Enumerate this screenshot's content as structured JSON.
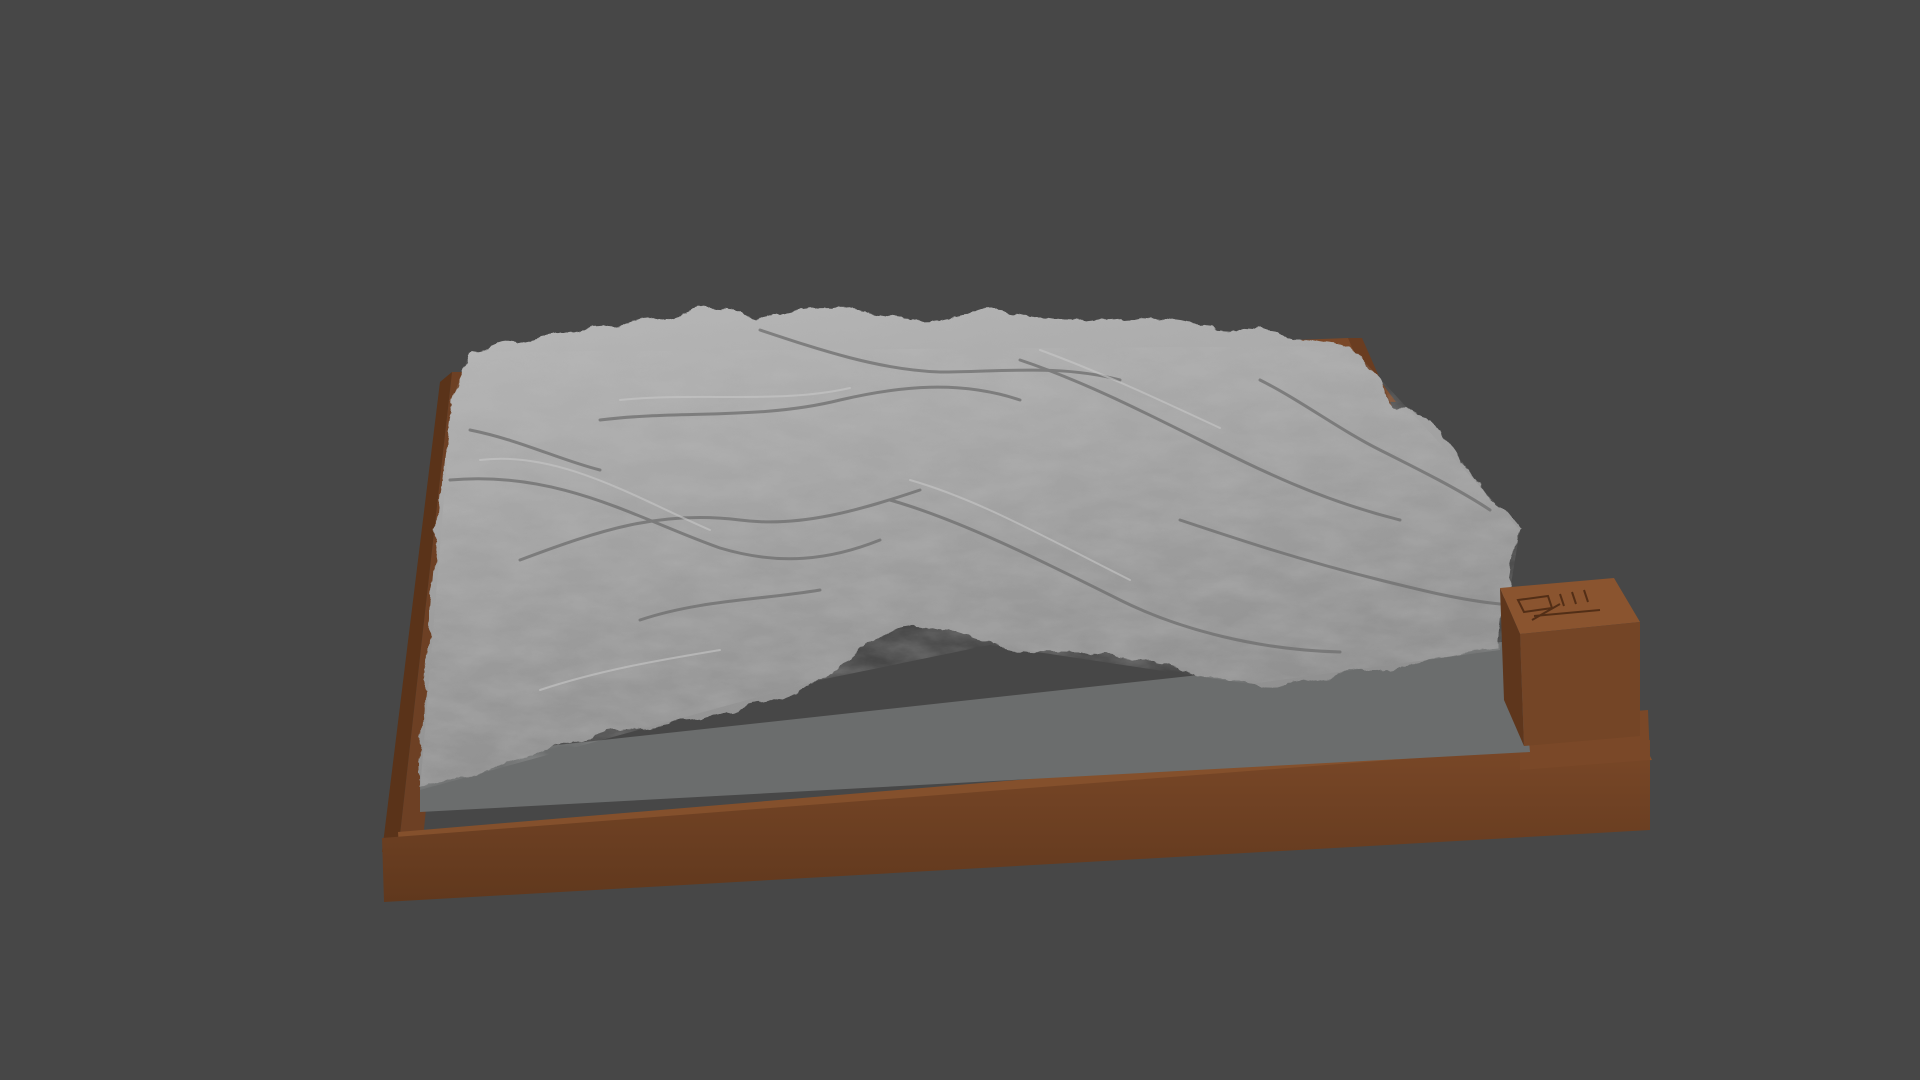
{
  "scene": {
    "background_color": "#474747",
    "model": {
      "description_visible": false,
      "frame_color": "#6b3f22",
      "frame_shadow_color": "#4f2e18",
      "terrain_color": "#9a9a9a",
      "terrain_light_color": "#b6b6b6",
      "terrain_dark_color": "#6f6f6f",
      "base_plate_color": "#6a6a6a",
      "label_block_color": "#744526"
    }
  }
}
